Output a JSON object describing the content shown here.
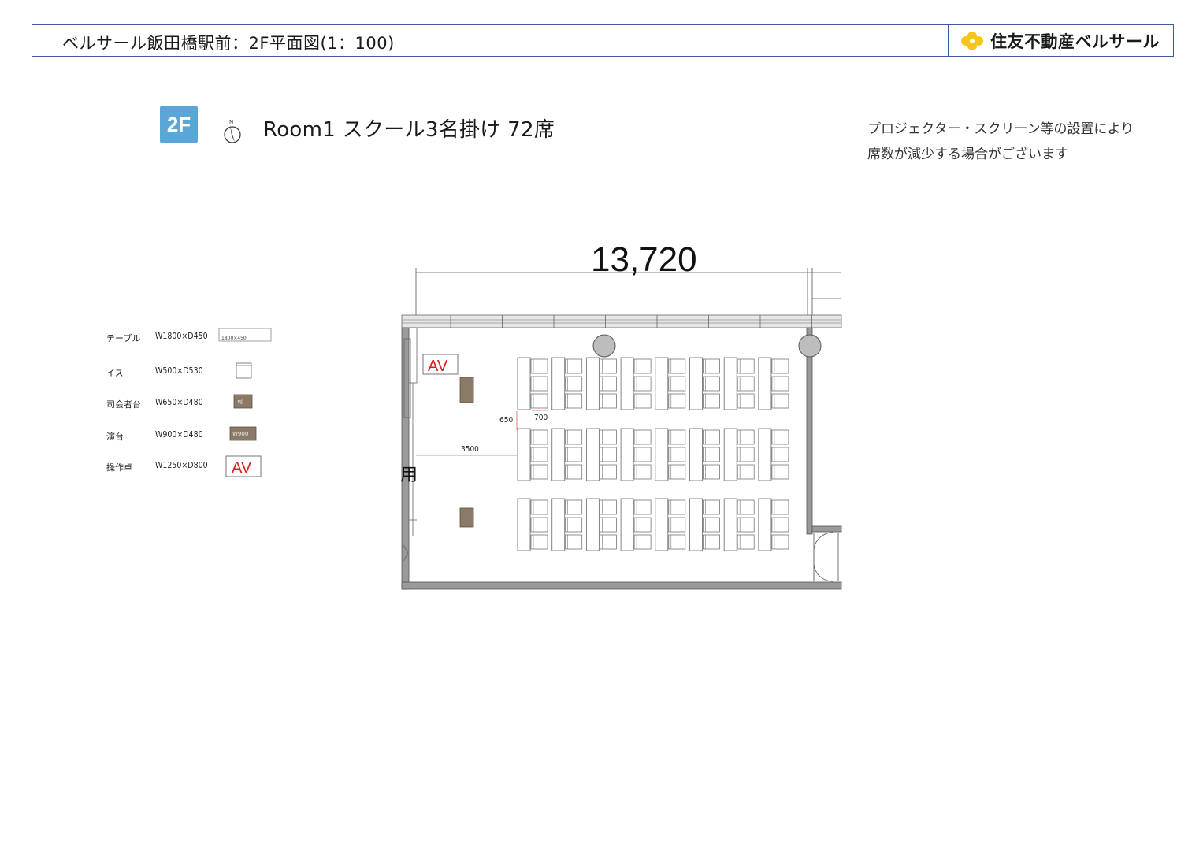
{
  "header": {
    "title": "ベルサール飯田橋駅前：2F平面図(1：100)",
    "brand": "住友不動産ベルサール",
    "brand_logo": "yellow-flower-logo",
    "border_color": "#3b5aa3",
    "logo_color": "#f5c518"
  },
  "room": {
    "floor_badge": "2F",
    "badge_color": "#5aa6d6",
    "title": "Room1 スクール3名掛け 72席",
    "north_label": "N",
    "note_line1": "プロジェクター・スクリーン等の設置により",
    "note_line2": "席数が減少する場合がございます"
  },
  "legend": [
    {
      "name": "テーブル",
      "size": "W1800×D450",
      "sample_label": "1800×450"
    },
    {
      "name": "イス",
      "size": "W500×D530",
      "sample_label": ""
    },
    {
      "name": "司会者台",
      "size": "W650×D480",
      "sample_label": "司"
    },
    {
      "name": "演台",
      "size": "W900×D480",
      "sample_label": "W900"
    },
    {
      "name": "操作卓",
      "size": "W1250×D800",
      "sample_label": "AV"
    }
  ],
  "plan": {
    "overall_dimension": "13,720",
    "dim_row_gap": "650",
    "dim_table_gap": "700",
    "dim_front": "3500",
    "av_label": "AV",
    "partial_text": "用",
    "table_blocks": 3,
    "tables_per_row": 8,
    "chairs_per_table": 3,
    "wall_color": "#555555",
    "furniture_brown": "#8b7a66",
    "av_red": "#d62020"
  }
}
